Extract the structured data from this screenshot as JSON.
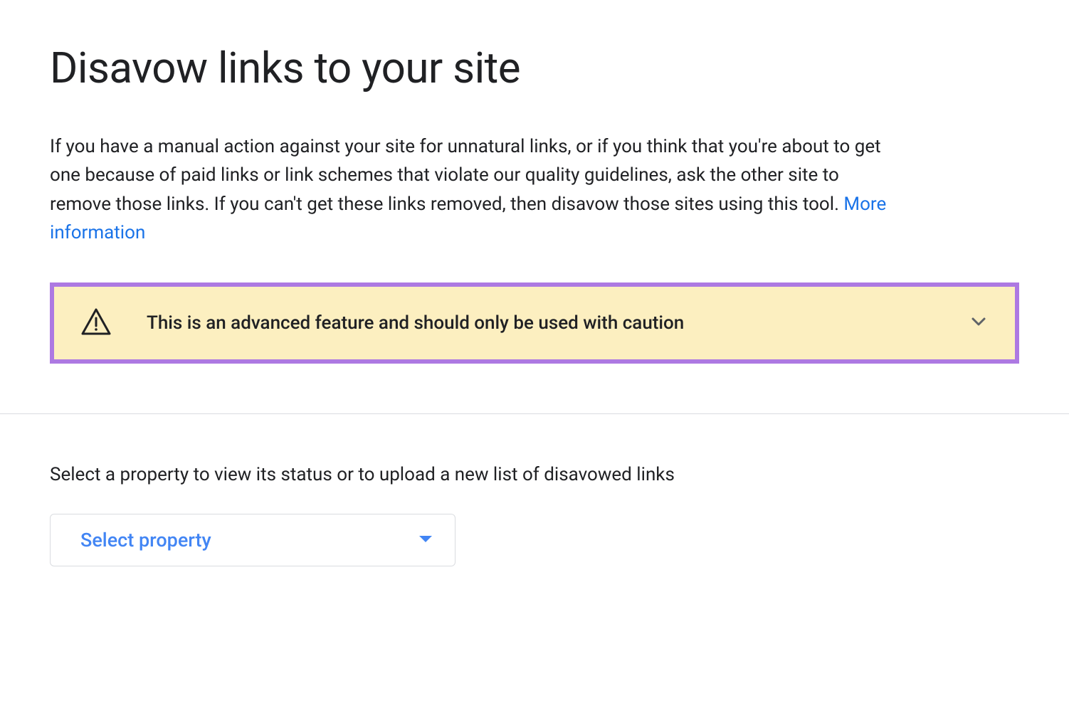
{
  "page": {
    "title": "Disavow links to your site",
    "description_text": "If you have a manual action against your site for unnatural links, or if you think that you're about to get one because of paid links or link schemes that violate our quality guidelines, ask the other site to remove those links. If you can't get these links removed, then disavow those sites using this tool. ",
    "more_info_label": "More information"
  },
  "warning": {
    "text": "This is an advanced feature and should only be used with caution"
  },
  "property_section": {
    "label": "Select a property to view its status or to upload a new list of disavowed links",
    "select_placeholder": "Select property"
  },
  "colors": {
    "link_blue": "#1a73e8",
    "select_blue": "#4285f4",
    "warning_bg": "#fcefc0",
    "warning_border": "#ad79e2",
    "text": "#202124",
    "border": "#dadce0"
  }
}
